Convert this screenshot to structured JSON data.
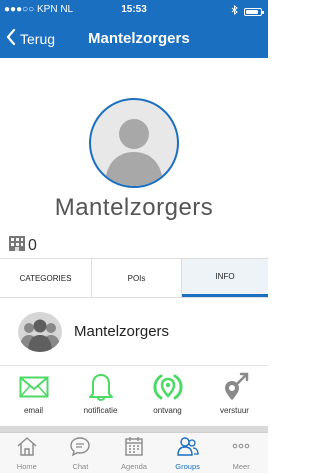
{
  "status_bar": {
    "carrier": "●●●○○ KPN NL",
    "time": "15:53",
    "battery_level": 0.85
  },
  "nav": {
    "back_label": "Terug",
    "title": "Mantelzorgers"
  },
  "profile": {
    "name": "Mantelzorgers",
    "count": "0"
  },
  "tabs": [
    {
      "label": "CATEGORIES",
      "selected": false
    },
    {
      "label": "POIs",
      "selected": false
    },
    {
      "label": "INFO",
      "selected": true
    }
  ],
  "group": {
    "name": "Mantelzorgers"
  },
  "actions": [
    {
      "label": "email",
      "icon": "envelope-icon"
    },
    {
      "label": "notificatie",
      "icon": "bell-icon"
    },
    {
      "label": "ontvang",
      "icon": "receive-location-icon"
    },
    {
      "label": "verstuur",
      "icon": "send-location-icon"
    }
  ],
  "tabbar": [
    {
      "label": "Home",
      "icon": "home-icon",
      "active": false
    },
    {
      "label": "Chat",
      "icon": "chat-icon",
      "active": false
    },
    {
      "label": "Agenda",
      "icon": "calendar-icon",
      "active": false
    },
    {
      "label": "Groups",
      "icon": "groups-icon",
      "active": true
    },
    {
      "label": "Meer",
      "icon": "more-icon",
      "active": false
    }
  ],
  "colors": {
    "brand_blue": "#1a6fc0",
    "action_green": "#4cd964",
    "action_gray": "#8a8a8a"
  }
}
